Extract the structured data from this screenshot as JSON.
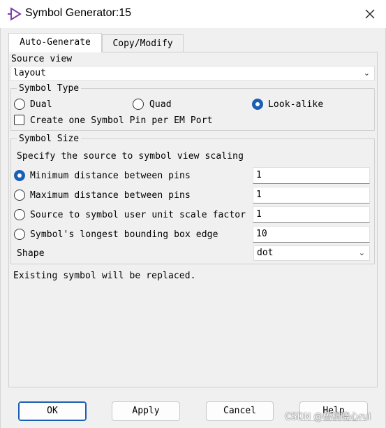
{
  "window": {
    "title": "Symbol Generator:15",
    "icon": "triangle-pin-icon",
    "close_icon": "close-icon"
  },
  "tabs": [
    {
      "label": "Auto-Generate",
      "active": true
    },
    {
      "label": "Copy/Modify",
      "active": false
    }
  ],
  "source_view": {
    "label": "Source view",
    "value": "layout"
  },
  "symbol_type": {
    "title": "Symbol Type",
    "options": [
      {
        "label": "Dual",
        "selected": false
      },
      {
        "label": "Quad",
        "selected": false
      },
      {
        "label": "Look-alike",
        "selected": true
      }
    ],
    "checkbox_label": "Create one Symbol Pin per EM Port",
    "checkbox_checked": false
  },
  "symbol_size": {
    "title": "Symbol Size",
    "description": "Specify the source to symbol view scaling",
    "options": [
      {
        "label": "Minimum distance between pins",
        "value": "1",
        "selected": true
      },
      {
        "label": "Maximum distance between pins",
        "value": "1",
        "selected": false
      },
      {
        "label": "Source to symbol user unit scale factor",
        "value": "1",
        "selected": false
      },
      {
        "label": "Symbol's longest bounding box edge",
        "value": "10",
        "selected": false
      }
    ],
    "shape_label": "Shape",
    "shape_value": "dot"
  },
  "status_message": "Existing symbol will be replaced.",
  "buttons": {
    "ok": "OK",
    "apply": "Apply",
    "cancel": "Cancel",
    "help": "Help"
  },
  "watermark": "CSDN @梧桐晓心rui",
  "colors": {
    "accent": "#1a5fb4",
    "title_icon": "#7a3fb0"
  }
}
